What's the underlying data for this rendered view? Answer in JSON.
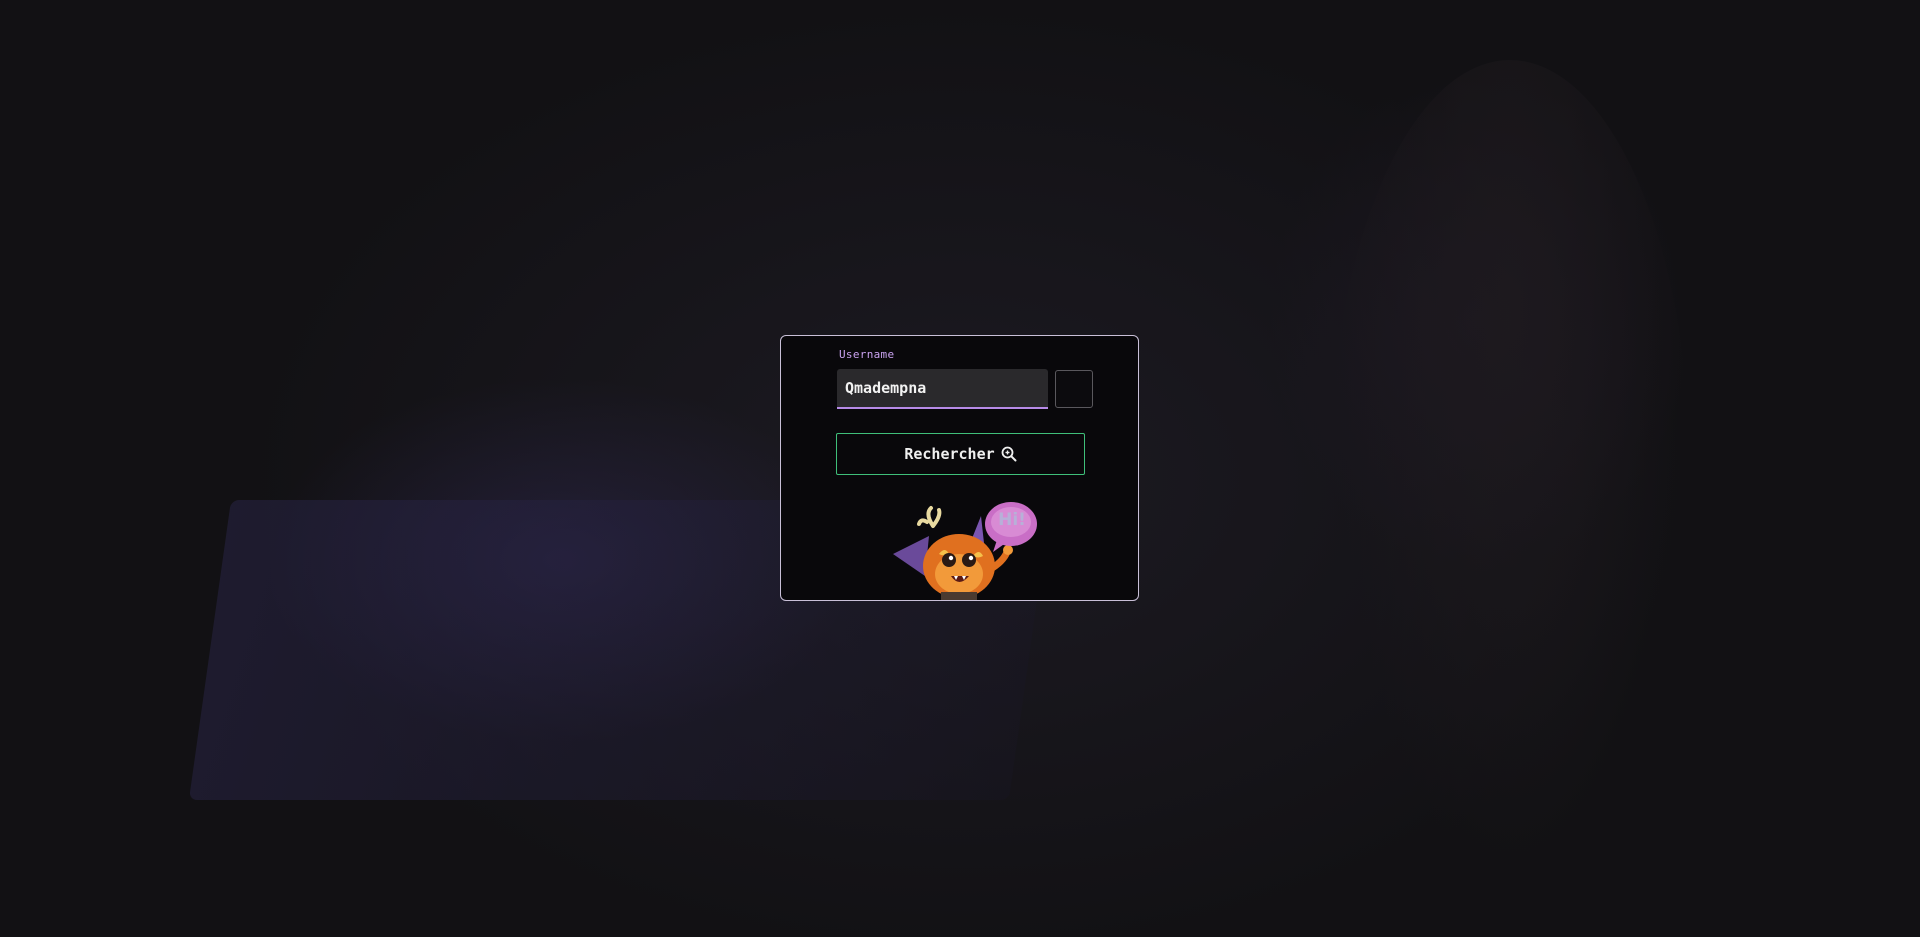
{
  "background": {
    "description_icon": "background-art"
  },
  "form": {
    "username_label": "Username",
    "username_value": "Qmadempna",
    "search_label": "Rechercher",
    "search_icon": "search-icon"
  },
  "mascot": {
    "bubble_text": "Hi!"
  },
  "colors": {
    "accent_purple": "#b78be8",
    "accent_green": "#3fbf7a",
    "card_border": "#c9c0d8"
  }
}
